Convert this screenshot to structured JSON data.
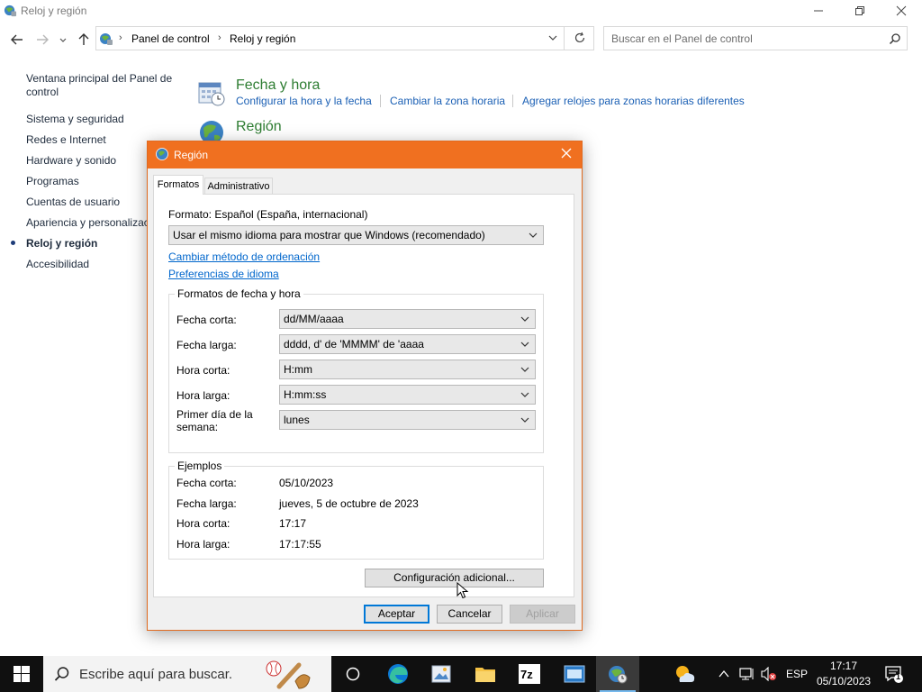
{
  "window": {
    "title": "Reloj y región",
    "breadcrumb": [
      "Panel de control",
      "Reloj y región"
    ],
    "search_placeholder": "Buscar en el Panel de control"
  },
  "sidebar": {
    "items": [
      {
        "label": "Ventana principal del Panel de control"
      },
      {
        "label": "Sistema y seguridad"
      },
      {
        "label": "Redes e Internet"
      },
      {
        "label": "Hardware y sonido"
      },
      {
        "label": "Programas"
      },
      {
        "label": "Cuentas de usuario"
      },
      {
        "label": "Apariencia y personalizac"
      },
      {
        "label": "Reloj y región",
        "selected": true
      },
      {
        "label": "Accesibilidad"
      }
    ]
  },
  "categories": [
    {
      "title": "Fecha y hora",
      "links": [
        "Configurar la hora y la fecha",
        "Cambiar la zona horaria",
        "Agregar relojes para zonas horarias diferentes"
      ]
    },
    {
      "title": "Región"
    }
  ],
  "dialog": {
    "title": "Región",
    "tabs": [
      "Formatos",
      "Administrativo"
    ],
    "format_label": "Formato: Español (España, internacional)",
    "format_select": "Usar el mismo idioma para mostrar que Windows (recomendado)",
    "link_sort": "Cambiar método de ordenación",
    "link_lang": "Preferencias de idioma",
    "formats_group": {
      "legend": "Formatos de fecha y hora",
      "rows": [
        {
          "label": "Fecha corta:",
          "value": "dd/MM/aaaa"
        },
        {
          "label": "Fecha larga:",
          "value": "dddd, d' de 'MMMM' de 'aaaa"
        },
        {
          "label": "Hora corta:",
          "value": "H:mm"
        },
        {
          "label": "Hora larga:",
          "value": "H:mm:ss"
        },
        {
          "label": "Primer día de la semana:",
          "value": "lunes"
        }
      ]
    },
    "examples_group": {
      "legend": "Ejemplos",
      "rows": [
        {
          "label": "Fecha corta:",
          "value": "05/10/2023"
        },
        {
          "label": "Fecha larga:",
          "value": "jueves, 5 de octubre de 2023"
        },
        {
          "label": "Hora corta:",
          "value": "17:17"
        },
        {
          "label": "Hora larga:",
          "value": "17:17:55"
        }
      ]
    },
    "additional_button": "Configuración adicional...",
    "buttons": {
      "ok": "Aceptar",
      "cancel": "Cancelar",
      "apply": "Aplicar"
    }
  },
  "taskbar": {
    "search_placeholder": "Escribe aquí para buscar.",
    "language": "ESP",
    "time": "17:17",
    "date": "05/10/2023",
    "notification_count": "1"
  }
}
